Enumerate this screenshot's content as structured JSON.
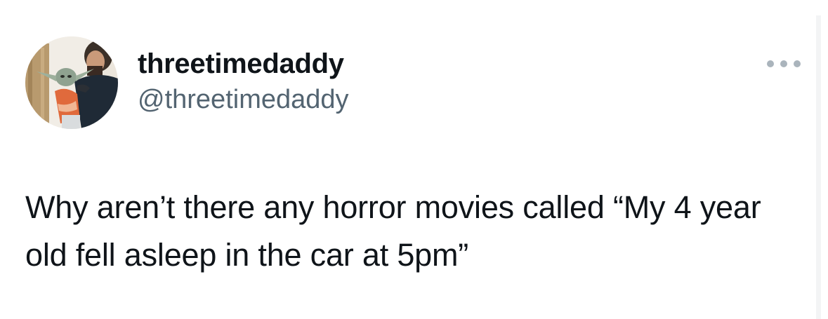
{
  "author": {
    "display_name": "threetimedaddy",
    "handle": "@threetimedaddy",
    "avatar_icon": "profile-photo"
  },
  "actions": {
    "more_icon": "more-horizontal-icon"
  },
  "tweet": {
    "text": "Why aren’t there any horror movies called “My 4 year old fell asleep in the car at 5pm”"
  },
  "colors": {
    "text_primary": "#0f1419",
    "text_secondary": "#536471",
    "icon_muted": "#aab4bc",
    "background": "#ffffff"
  }
}
